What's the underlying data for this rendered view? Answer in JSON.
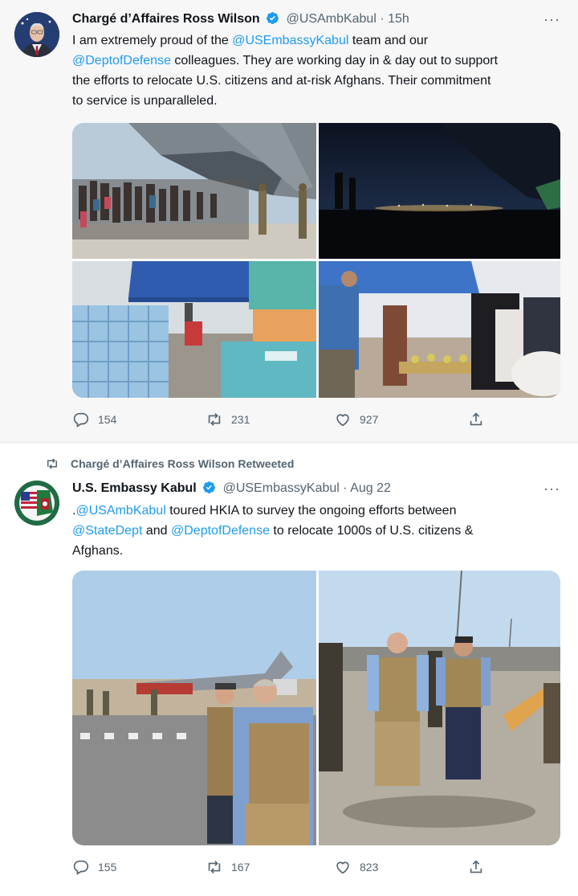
{
  "tweets": [
    {
      "author_name": "Chargé d’Affaires Ross Wilson",
      "handle": "@USAmbKabul",
      "separator": "·",
      "time": "15h",
      "more": "···",
      "text": {
        "t1": "I am extremely proud of the ",
        "m1": "@USEmbassyKabul",
        "t2": " team and our",
        "m2": "@DeptofDefense",
        "t3": " colleagues. They are working day in & day out to support",
        "t4": "the efforts to relocate U.S. citizens and at-risk Afghans. Their commitment",
        "t5": "to service is unparalleled."
      },
      "counts": {
        "replies": "154",
        "retweets": "231",
        "likes": "927"
      }
    },
    {
      "retweeted_by": "Chargé d’Affaires Ross Wilson Retweeted",
      "author_name": "U.S. Embassy Kabul",
      "handle": "@USEmbassyKabul",
      "separator": "·",
      "time": "Aug 22",
      "more": "···",
      "text": {
        "t0": ".",
        "m1": "@USAmbKabul",
        "t1": "  toured HKIA to survey the ongoing efforts between",
        "m2": "@StateDept",
        "t2": " and ",
        "m3": "@DeptofDefense",
        "t3": " to relocate 1000s of U.S. citizens &",
        "t4": "Afghans."
      },
      "counts": {
        "replies": "155",
        "retweets": "167",
        "likes": "823"
      }
    }
  ],
  "icons": {
    "verified": "verified-badge-icon",
    "reply": "reply-icon",
    "retweet": "retweet-icon",
    "like": "heart-icon",
    "share": "share-icon"
  },
  "colors": {
    "accent": "#1d9bf0",
    "muted": "#536471",
    "text": "#0f1419"
  }
}
